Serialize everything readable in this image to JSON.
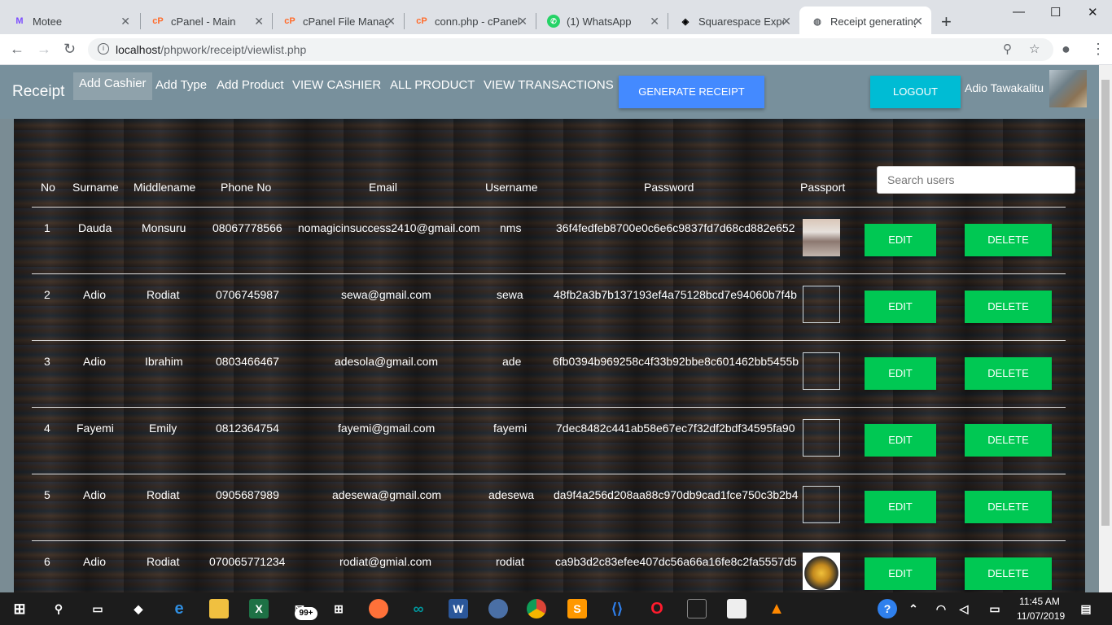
{
  "browser": {
    "tabs": [
      {
        "title": "Motee",
        "icon": "motee-icon",
        "color": "#7c4dff"
      },
      {
        "title": "cPanel - Main",
        "icon": "cpanel-icon",
        "color": "#ff6c2c"
      },
      {
        "title": "cPanel File Manag",
        "icon": "cpanel-icon",
        "color": "#ff6c2c"
      },
      {
        "title": "conn.php - cPanel",
        "icon": "cpanel-icon",
        "color": "#ff6c2c"
      },
      {
        "title": "(1) WhatsApp",
        "icon": "whatsapp-icon",
        "color": "#25d366"
      },
      {
        "title": "Squarespace Expe",
        "icon": "squarespace-icon",
        "color": "#000000"
      },
      {
        "title": "Receipt generating",
        "icon": "globe-icon",
        "color": "#5f6368"
      }
    ],
    "url_host": "localhost",
    "url_path": "/phpwork/receipt/viewlist.php"
  },
  "navbar": {
    "brand": "Receipt",
    "links": [
      "Add Cashier",
      "Add Type",
      "Add Product",
      "VIEW CASHIER",
      "ALL PRODUCT",
      "VIEW TRANSACTIONS"
    ],
    "generate_label": "GENERATE RECEIPT",
    "logout_label": "LOGOUT",
    "user_name": "Adio Tawakalitu"
  },
  "table": {
    "headers": [
      "No",
      "Surname",
      "Middlename",
      "Phone No",
      "Email",
      "Username",
      "Password",
      "Passport"
    ],
    "search_placeholder": "Search users",
    "edit_label": "EDIT",
    "delete_label": "DELETE",
    "rows": [
      {
        "no": "1",
        "surname": "Dauda",
        "middlename": "Monsuru",
        "phone": "08067778566",
        "email": "nomagicinsuccess2410@gmail.com",
        "username": "nms",
        "password": "36f4fedfeb8700e0c6e6c9837fd7d68cd882e652"
      },
      {
        "no": "2",
        "surname": "Adio",
        "middlename": "Rodiat",
        "phone": "0706745987",
        "email": "sewa@gmail.com",
        "username": "sewa",
        "password": "48fb2a3b7b137193ef4a75128bcd7e94060b7f4b"
      },
      {
        "no": "3",
        "surname": "Adio",
        "middlename": "Ibrahim",
        "phone": "0803466467",
        "email": "adesola@gmail.com",
        "username": "ade",
        "password": "6fb0394b969258c4f33b92bbe8c601462bb5455b"
      },
      {
        "no": "4",
        "surname": "Fayemi",
        "middlename": "Emily",
        "phone": "0812364754",
        "email": "fayemi@gmail.com",
        "username": "fayemi",
        "password": "7dec8482c441ab58e67ec7f32df2bdf34595fa90"
      },
      {
        "no": "5",
        "surname": "Adio",
        "middlename": "Rodiat",
        "phone": "0905687989",
        "email": "adesewa@gmail.com",
        "username": "adesewa",
        "password": "da9f4a256d208aa88c970db9cad1fce750c3b2b4"
      },
      {
        "no": "6",
        "surname": "Adio",
        "middlename": "Rodiat",
        "phone": "070065771234",
        "email": "rodiat@gmial.com",
        "username": "rodiat",
        "password": "ca9b3d2c83efee407dc56a66a16fe8c2fa5557d5"
      }
    ]
  },
  "taskbar": {
    "time": "11:45 AM",
    "date": "11/07/2019",
    "mail_badge": "99+"
  }
}
